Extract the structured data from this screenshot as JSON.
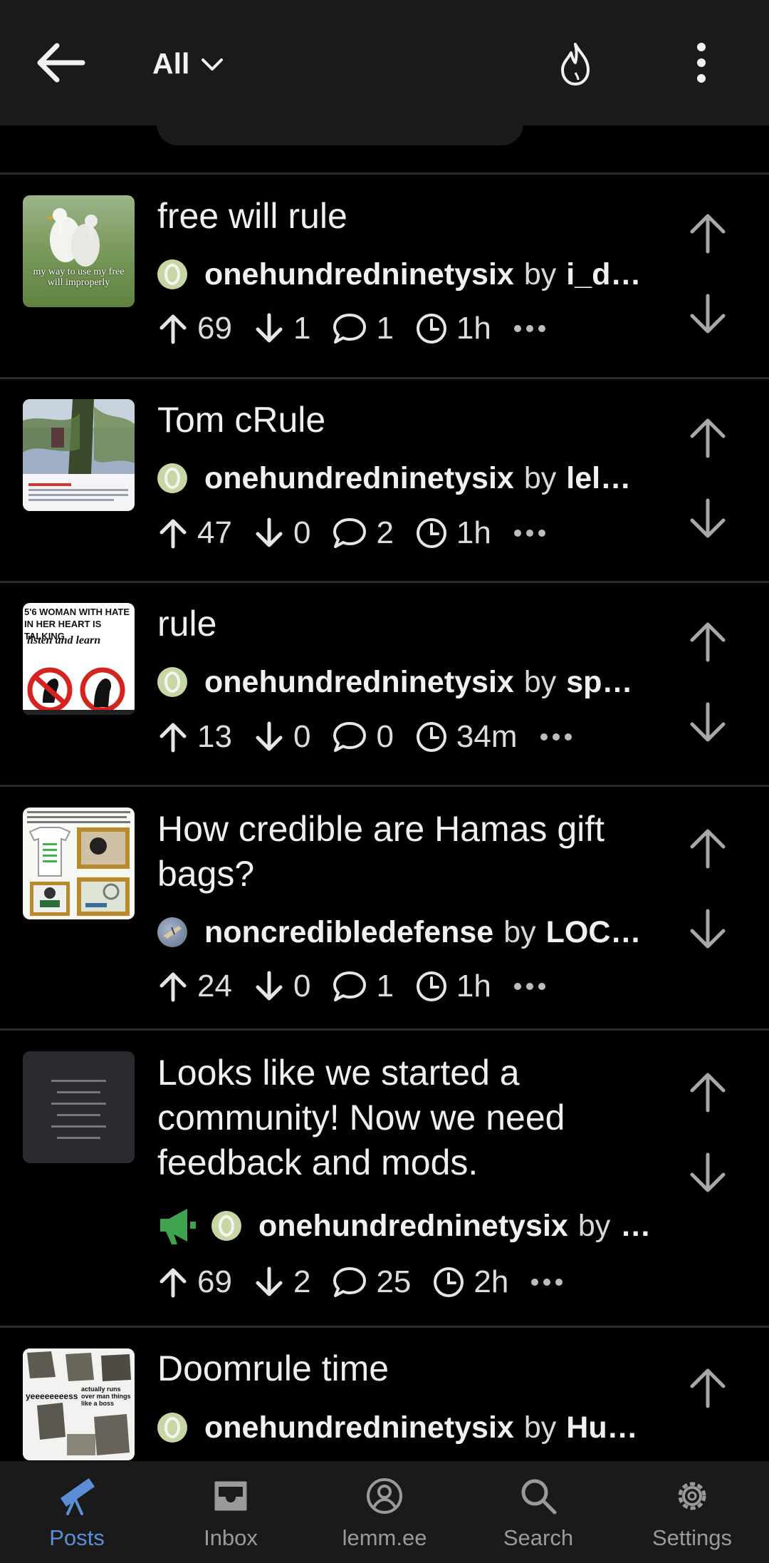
{
  "header": {
    "back_icon": "arrow-left-icon",
    "feed_label": "All",
    "sort_icon": "flame-icon",
    "more_icon": "dots-vertical-icon"
  },
  "posts": [
    {
      "title": "free will rule",
      "community": "onehundredninetysix",
      "by": "by",
      "author": "i_d…",
      "upvotes": "69",
      "downvotes": "1",
      "comments": "1",
      "time": "1h",
      "thumb_text": "my way to use my free will improperly"
    },
    {
      "title": "Tom cRule",
      "community": "onehundredninetysix",
      "by": "by",
      "author": "lelg…",
      "upvotes": "47",
      "downvotes": "0",
      "comments": "2",
      "time": "1h"
    },
    {
      "title": "rule",
      "community": "onehundredninetysix",
      "by": "by",
      "author": "spu…",
      "upvotes": "13",
      "downvotes": "0",
      "comments": "0",
      "time": "34m",
      "thumb_text_1": "5'6 WOMAN WITH HATE IN HER HEART IS TALKING",
      "thumb_text_2": "listen and learn"
    },
    {
      "title": "How credible are Hamas gift bags?",
      "community": "noncredibledefense",
      "by": "by",
      "author": "LOC…",
      "upvotes": "24",
      "downvotes": "0",
      "comments": "1",
      "time": "1h"
    },
    {
      "title": "Looks like we started a community! Now we need feedback and mods.",
      "community": "onehundredninetysix",
      "by": "by",
      "author": "…",
      "upvotes": "69",
      "downvotes": "2",
      "comments": "25",
      "time": "2h",
      "featured_icon": "megaphone-icon"
    },
    {
      "title": "Doomrule time",
      "community": "onehundredninetysix",
      "by": "by",
      "author": "Hu…",
      "thumb_text_1": "yeeeeeeeess",
      "thumb_text_2": "actually runs over man things like a boss"
    }
  ],
  "nav": {
    "posts": "Posts",
    "inbox": "Inbox",
    "account": "lemm.ee",
    "search": "Search",
    "settings": "Settings"
  },
  "colors": {
    "background": "#000000",
    "bar": "#1a1a1a",
    "accent": "#5a8fd8",
    "divider": "#2b2b2b",
    "megaphone": "#3fa34d"
  }
}
